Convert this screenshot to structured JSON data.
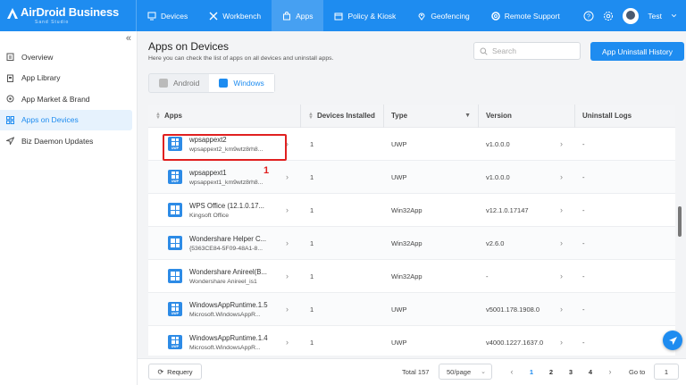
{
  "brand": {
    "name": "AirDroid Business",
    "tagline": "Sand Studio"
  },
  "nav": [
    {
      "label": "Devices",
      "icon": "monitor-icon",
      "active": false
    },
    {
      "label": "Workbench",
      "icon": "tools-icon",
      "active": false
    },
    {
      "label": "Apps",
      "icon": "bag-icon",
      "active": true
    },
    {
      "label": "Policy & Kiosk",
      "icon": "folder-icon",
      "active": false
    },
    {
      "label": "Geofencing",
      "icon": "map-pin-icon",
      "active": false
    },
    {
      "label": "Remote Support",
      "icon": "lifebuoy-icon",
      "active": false
    }
  ],
  "user": {
    "name": "Test"
  },
  "sidebar": {
    "items": [
      {
        "label": "Overview",
        "icon": "clipboard-icon"
      },
      {
        "label": "App Library",
        "icon": "app-library-icon"
      },
      {
        "label": "App Market & Brand",
        "icon": "target-icon"
      },
      {
        "label": "Apps on Devices",
        "icon": "grid-icon",
        "active": true
      },
      {
        "label": "Biz Daemon Updates",
        "icon": "send-icon"
      }
    ]
  },
  "page": {
    "title": "Apps on Devices",
    "description": "Here you can check the list of apps on all devices and uninstall apps."
  },
  "search": {
    "placeholder": "Search"
  },
  "history_button": "App Uninstall History",
  "platform_tabs": [
    {
      "label": "Android",
      "active": false
    },
    {
      "label": "Windows",
      "active": true
    }
  ],
  "table": {
    "columns": [
      "Apps",
      "Devices Installed",
      "Type",
      "Version",
      "Uninstall Logs"
    ],
    "rows": [
      {
        "name": "wpsappext2",
        "id": "wpsappext2_km9wtz8rh8...",
        "installed": "1",
        "type": "UWP",
        "version": "v1.0.0.0",
        "logs": "-",
        "icon": "uwp"
      },
      {
        "name": "wpsappext1",
        "id": "wpsappext1_km9wtz8rh8...",
        "installed": "1",
        "type": "UWP",
        "version": "v1.0.0.0",
        "logs": "-",
        "icon": "uwp"
      },
      {
        "name": "WPS Office (12.1.0.17...",
        "id": "Kingsoft Office",
        "installed": "1",
        "type": "Win32App",
        "version": "v12.1.0.17147",
        "logs": "-",
        "icon": "win"
      },
      {
        "name": "Wondershare Helper C...",
        "id": "{5363CE84-5F09-48A1-8...",
        "installed": "1",
        "type": "Win32App",
        "version": "v2.6.0",
        "logs": "-",
        "icon": "win"
      },
      {
        "name": "Wondershare Anireel(B...",
        "id": "Wondershare Anireel_is1",
        "installed": "1",
        "type": "Win32App",
        "version": "-",
        "logs": "-",
        "icon": "win"
      },
      {
        "name": "WindowsAppRuntime.1.5",
        "id": "Microsoft.WindowsAppR...",
        "installed": "1",
        "type": "UWP",
        "version": "v5001.178.1908.0",
        "logs": "-",
        "icon": "uwp"
      },
      {
        "name": "WindowsAppRuntime.1.4",
        "id": "Microsoft.WindowsAppR...",
        "installed": "1",
        "type": "UWP",
        "version": "v4000.1227.1637.0",
        "logs": "-",
        "icon": "uwp"
      }
    ]
  },
  "annotation": {
    "label": "1",
    "color": "#e02020"
  },
  "footer": {
    "requery": "Requery",
    "total": "Total 157",
    "page_size": "50/page",
    "pages": [
      "1",
      "2",
      "3",
      "4"
    ],
    "current_page": "1",
    "goto_label": "Go to",
    "goto_value": "1"
  },
  "colors": {
    "accent": "#1e8cf0",
    "highlight": "#e02020"
  }
}
